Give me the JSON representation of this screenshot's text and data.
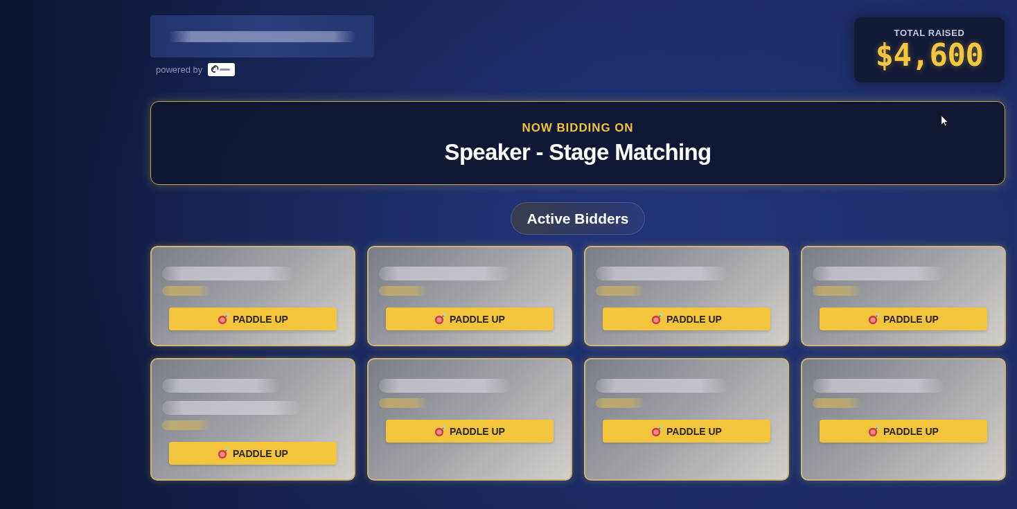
{
  "header": {
    "powered_by": "powered by"
  },
  "total_raised": {
    "label": "TOTAL RAISED",
    "amount": "$4,600"
  },
  "now_bidding": {
    "label": "NOW BIDDING ON",
    "item": "Speaker - Stage Matching"
  },
  "bidders_section": {
    "title": "Active Bidders",
    "bidders": [
      {
        "kind": "single",
        "button": "PADDLE UP"
      },
      {
        "kind": "single",
        "button": "PADDLE UP"
      },
      {
        "kind": "single",
        "button": "PADDLE UP"
      },
      {
        "kind": "single",
        "button": "PADDLE UP"
      },
      {
        "kind": "wrapped",
        "button": "PADDLE UP"
      },
      {
        "kind": "single",
        "button": "PADDLE UP"
      },
      {
        "kind": "single",
        "button": "PADDLE UP"
      },
      {
        "kind": "single",
        "button": "PADDLE UP"
      }
    ]
  }
}
